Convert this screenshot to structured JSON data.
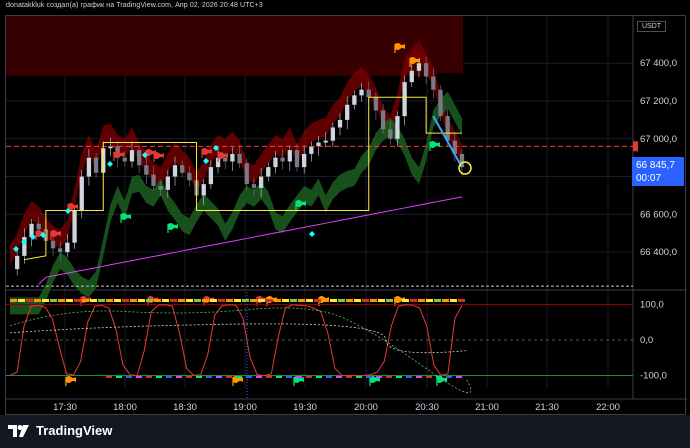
{
  "header": {
    "text": "donatakkluk создал(а) график на TradingView.com, Апр 02, 2026 20:48 UTC+3"
  },
  "currency_label": "USDT",
  "price_tag": {
    "price": "66 845,7",
    "countdown": "00:07"
  },
  "brand": {
    "name": "TradingView"
  },
  "colors": {
    "background": "#000000",
    "up": "#26a69a",
    "flag_red": "#e53935",
    "flag_green": "#00e676",
    "flag_orange": "#ff9800",
    "yellow": "#ffeb3b",
    "magenta": "#e040fb",
    "price_tag": "#2962ff",
    "cloud_red": "#7f0000",
    "cloud_green": "#1b5e20"
  },
  "chart_data": [
    {
      "type": "line",
      "title": "",
      "series": [
        {
          "values": [
            66310,
            66380,
            66480,
            66550,
            66520,
            66460,
            66420,
            66400,
            66450,
            66620,
            66800,
            66900,
            66820,
            66950,
            66960,
            66900,
            66880,
            66940,
            66860,
            66810,
            66750,
            66730,
            66800,
            66860,
            66820,
            66780,
            66700,
            66760,
            66850,
            66900,
            66880,
            66920,
            66870,
            66760,
            66740,
            66800,
            66850,
            66900,
            66880,
            66940,
            66850,
            66920,
            66960,
            66980,
            66990,
            67060,
            67100,
            67180,
            67230,
            67260,
            67220,
            67150,
            67050,
            67000,
            67120,
            67300,
            67360,
            67400,
            67330,
            67260,
            67120,
            66990,
            66920,
            66850
          ]
        }
      ],
      "x_ticks": [
        "17:30",
        "18:00",
        "18:30",
        "19:00",
        "19:30",
        "20:00",
        "20:30",
        "21:00",
        "21:30",
        "22:00"
      ],
      "y_ticks": [
        "67 400,0",
        "67 200,0",
        "67 000,0",
        "66 800,0",
        "66 600,0",
        "66 400,0"
      ],
      "ylim": [
        66210,
        67650
      ],
      "price_line": 66960
    },
    {
      "type": "line",
      "title": "",
      "series": [
        {
          "values": [
            -100,
            -90,
            40,
            95,
            98,
            92,
            60,
            -20,
            -95,
            -98,
            -60,
            50,
            95,
            98,
            90,
            30,
            -70,
            -98,
            -100,
            -30,
            80,
            98,
            99,
            95,
            20,
            -80,
            -99,
            -98,
            -40,
            70,
            96,
            99,
            98,
            60,
            -50,
            -97,
            -100,
            -95,
            10,
            90,
            99,
            98,
            96,
            90,
            80,
            20,
            -80,
            -99,
            -100,
            -100,
            -100,
            -98,
            -90,
            -60,
            40,
            95,
            99,
            98,
            90,
            40,
            -70,
            -99,
            -95,
            60,
            98
          ]
        }
      ],
      "y_ticks": [
        "100,0",
        "0,0",
        "-100,0"
      ],
      "ylim": [
        -135,
        135
      ]
    }
  ]
}
